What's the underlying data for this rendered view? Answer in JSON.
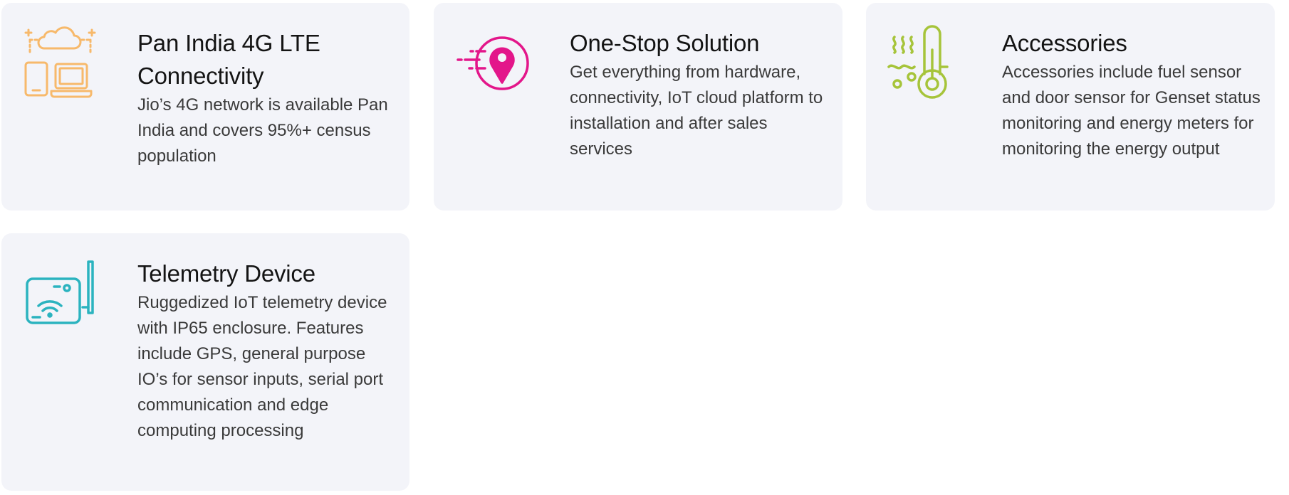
{
  "cards": [
    {
      "title": "Pan India 4G LTE Connectivity",
      "description": "Jio’s 4G network is available Pan India and covers 95%+ census population",
      "icon": "cloud-devices-icon",
      "color": "#f7b96b"
    },
    {
      "title": "One-Stop Solution",
      "description": "Get everything from hardware, connectivity, IoT cloud platform to installation and after sales services",
      "icon": "location-pin-icon",
      "color": "#e3168a"
    },
    {
      "title": "Accessories",
      "description": "Accessories include fuel sensor and door sensor for Genset status monitoring and energy meters for monitoring the energy output",
      "icon": "thermometer-icon",
      "color": "#a6c43a"
    },
    {
      "title": "Telemetry Device",
      "description": "Ruggedized IoT telemetry device with IP65 enclosure. Features include GPS, general purpose IO’s for sensor inputs, serial port communication and edge computing processing",
      "icon": "telemetry-device-icon",
      "color": "#2bb3bf"
    }
  ]
}
